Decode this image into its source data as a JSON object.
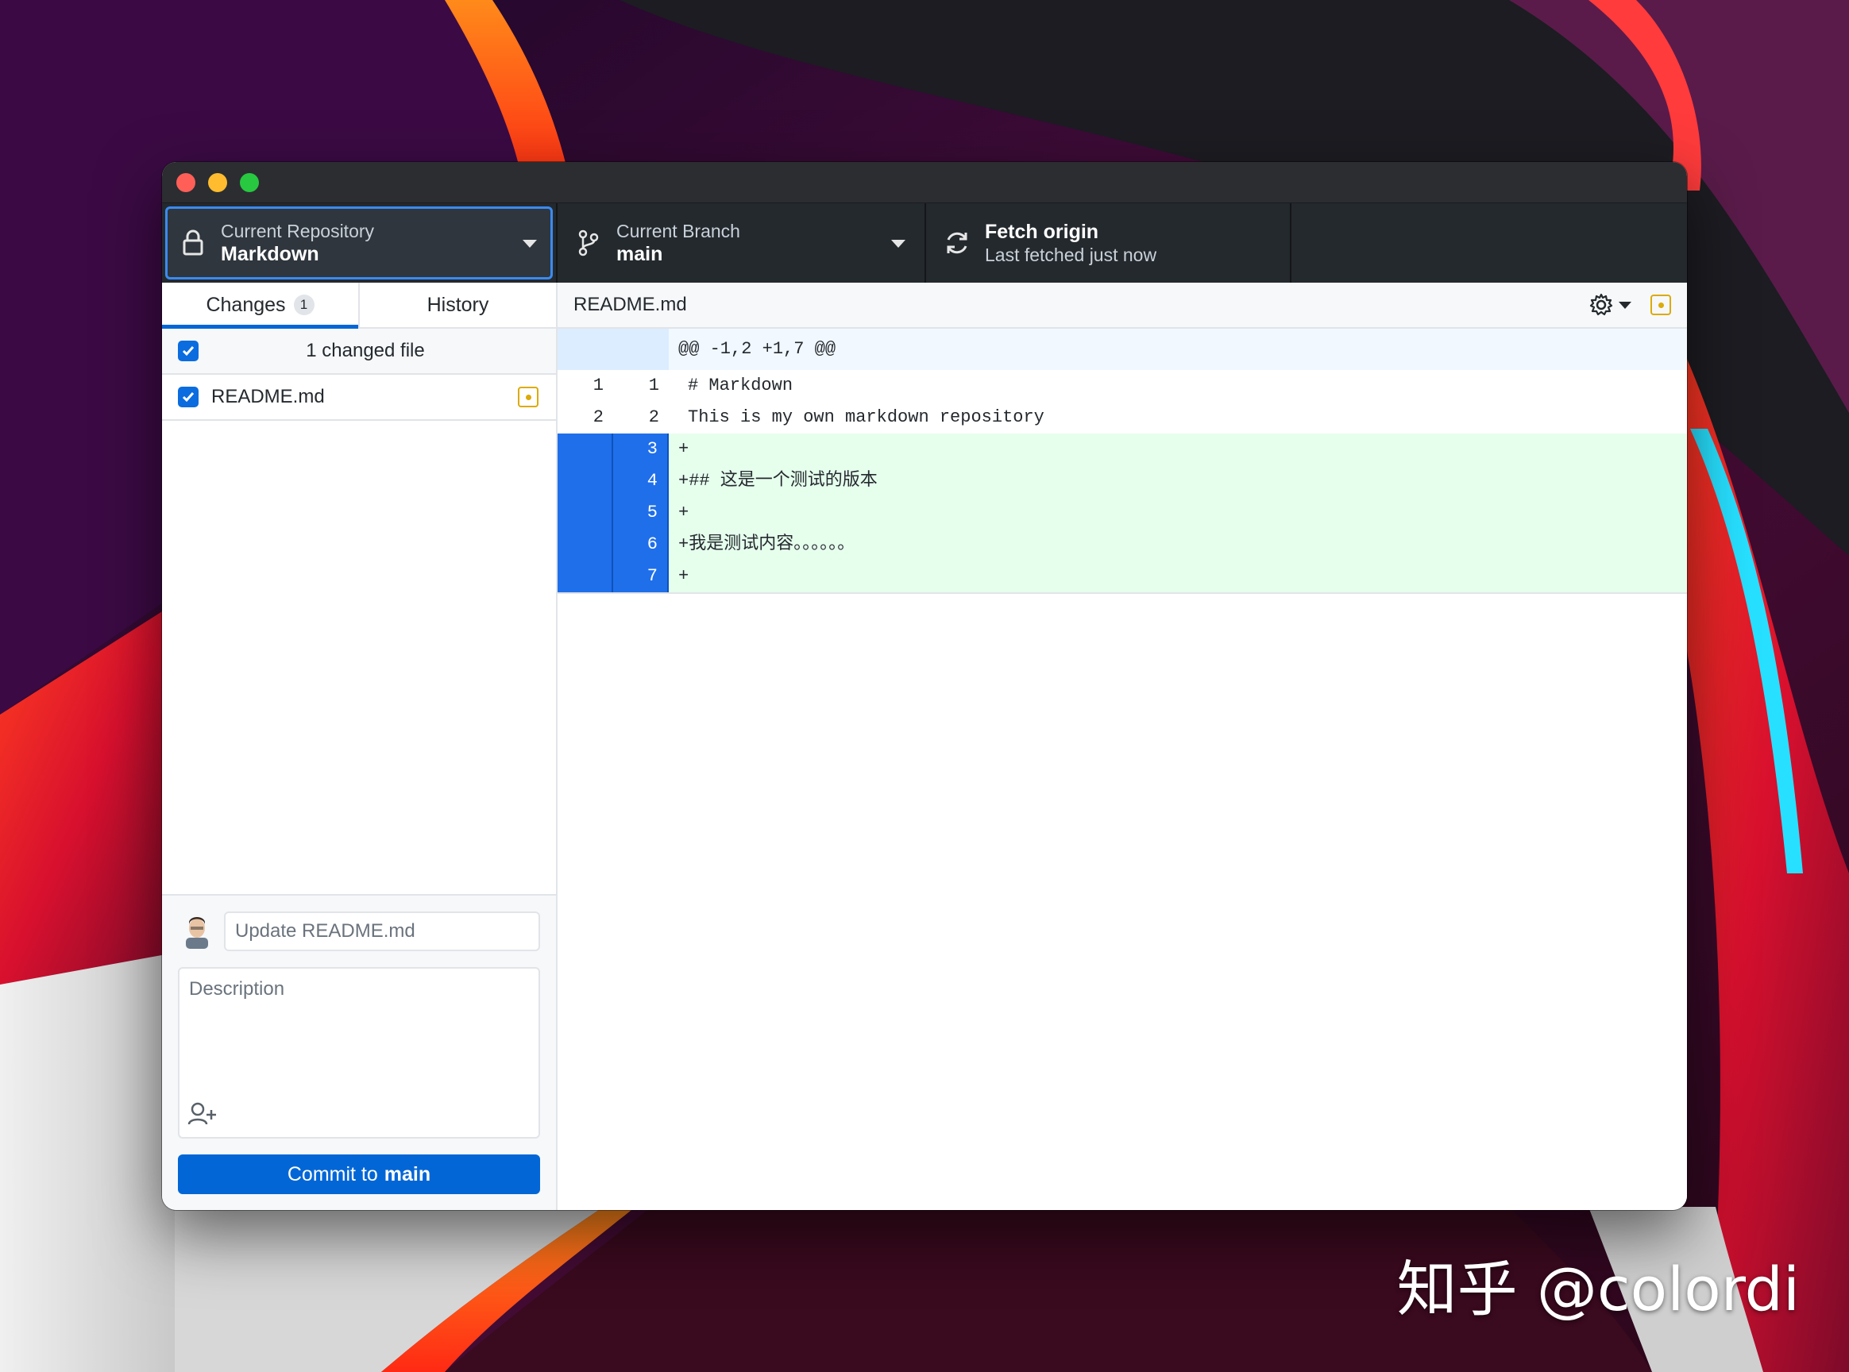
{
  "window": {
    "toolbar": {
      "repository": {
        "label": "Current Repository",
        "value": "Markdown"
      },
      "branch": {
        "label": "Current Branch",
        "value": "main"
      },
      "fetch": {
        "title": "Fetch origin",
        "status": "Last fetched just now"
      }
    },
    "sidebar": {
      "tabs": [
        {
          "label": "Changes",
          "count": "1",
          "active": true
        },
        {
          "label": "History",
          "active": false
        }
      ],
      "changed_files_header": "1 changed file",
      "files": [
        {
          "name": "README.md",
          "status": "modified",
          "checked": true
        }
      ],
      "commit": {
        "summary_placeholder": "Update README.md",
        "description_placeholder": "Description",
        "button_prefix": "Commit to",
        "button_branch": "main"
      }
    },
    "diff": {
      "file_path": "README.md",
      "hunk_header": "@@ -1,2 +1,7 @@",
      "lines": [
        {
          "type": "context",
          "old": "1",
          "new": "1",
          "text": "# Markdown"
        },
        {
          "type": "context",
          "old": "2",
          "new": "2",
          "text": "This is my own markdown repository"
        },
        {
          "type": "add",
          "old": "",
          "new": "3",
          "text": "+"
        },
        {
          "type": "add",
          "old": "",
          "new": "4",
          "text": "+## 这是一个测试的版本"
        },
        {
          "type": "add",
          "old": "",
          "new": "5",
          "text": "+"
        },
        {
          "type": "add",
          "old": "",
          "new": "6",
          "text": "+我是测试内容。。。。。。"
        },
        {
          "type": "add",
          "old": "",
          "new": "7",
          "text": "+"
        }
      ]
    }
  },
  "watermark": "知乎 @colordi",
  "colors": {
    "accent": "#0366d6",
    "toolbar_bg": "#24292e",
    "added_bg": "#e6ffed",
    "added_gutter": "#1f6feb",
    "modified": "#dbab09"
  },
  "icons": {
    "repository": "lock-icon",
    "branch": "git-branch-icon",
    "fetch": "sync-icon",
    "settings": "gear-icon",
    "file_status": "file-modified-icon",
    "coauthor": "person-add-icon"
  }
}
